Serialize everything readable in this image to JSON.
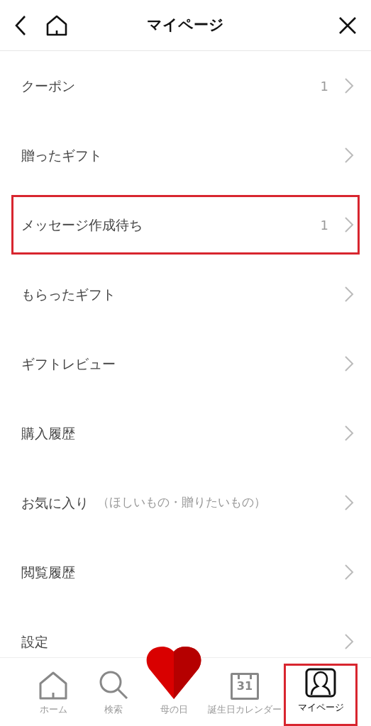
{
  "header": {
    "title": "マイページ"
  },
  "menu": [
    {
      "label": "クーポン",
      "count": "1",
      "highlighted": false
    },
    {
      "label": "贈ったギフト",
      "highlighted": false
    },
    {
      "label": "メッセージ作成待ち",
      "count": "1",
      "highlighted": true
    },
    {
      "label": "もらったギフト",
      "highlighted": false
    },
    {
      "label": "ギフトレビュー",
      "highlighted": false
    },
    {
      "label": "購入履歴",
      "highlighted": false
    },
    {
      "label": "お気に入り",
      "note": "（ほしいもの・贈りたいもの）",
      "highlighted": false
    },
    {
      "label": "閲覧履歴",
      "highlighted": false
    },
    {
      "label": "設定",
      "highlighted": false
    }
  ],
  "tab_bar": [
    {
      "kind": "home",
      "label": "ホーム",
      "selected": false,
      "highlighted": false
    },
    {
      "kind": "search",
      "label": "検索",
      "selected": false,
      "highlighted": false
    },
    {
      "kind": "heart",
      "label": "母の日",
      "selected": false,
      "highlighted": false
    },
    {
      "kind": "calendar",
      "label": "誕生日カレンダー",
      "day": "31",
      "selected": false,
      "highlighted": false
    },
    {
      "kind": "profile",
      "label": "マイページ",
      "selected": true,
      "highlighted": true
    }
  ]
}
